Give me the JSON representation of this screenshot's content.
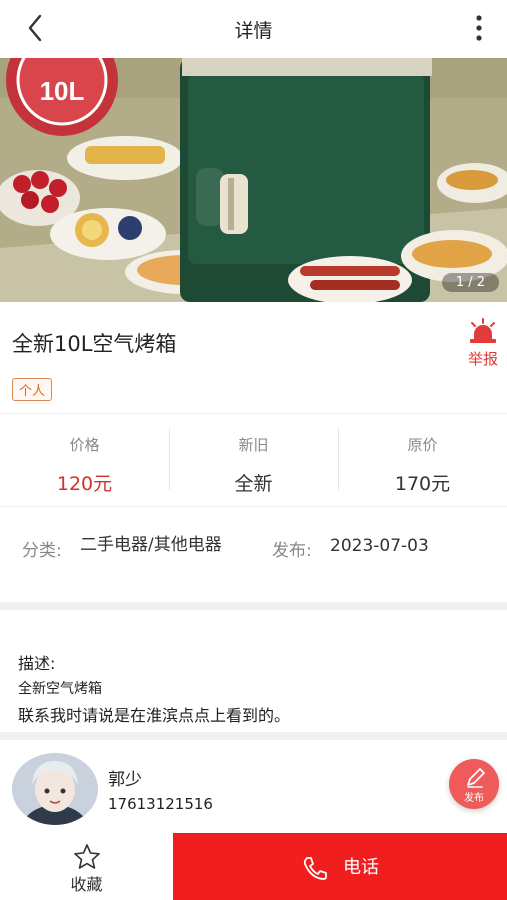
{
  "header": {
    "title": "详情"
  },
  "gallery": {
    "pager": "1 / 2",
    "badge_text": "10L"
  },
  "product": {
    "title": "全新10L空气烤箱",
    "report_label": "举报",
    "seller_type": "个人"
  },
  "stats": [
    {
      "label": "价格",
      "value": "120元"
    },
    {
      "label": "新旧",
      "value": "全新"
    },
    {
      "label": "原价",
      "value": "170元"
    }
  ],
  "meta": {
    "category_label": "分类:",
    "category_value": "二手电器/其他电器",
    "publish_label": "发布:",
    "publish_value": "2023-07-03"
  },
  "description": {
    "label": "描述:",
    "line1": "全新空气烤箱",
    "line2": "联系我时请说是在淮滨点点上看到的。"
  },
  "seller": {
    "name": "郭少",
    "phone": "17613121516",
    "publish_label": "发布"
  },
  "bottom": {
    "favorite_label": "收藏",
    "call_label": "电话"
  },
  "colors": {
    "accent_red": "#f01e1e",
    "price_red": "#d0342c",
    "tag_orange": "#d66a2a"
  },
  "icons": {
    "back": "back-arrow-icon",
    "more": "more-vertical-icon",
    "report": "alarm-siren-icon",
    "publish": "pencil-icon",
    "favorite": "star-outline-icon",
    "call": "phone-icon"
  }
}
